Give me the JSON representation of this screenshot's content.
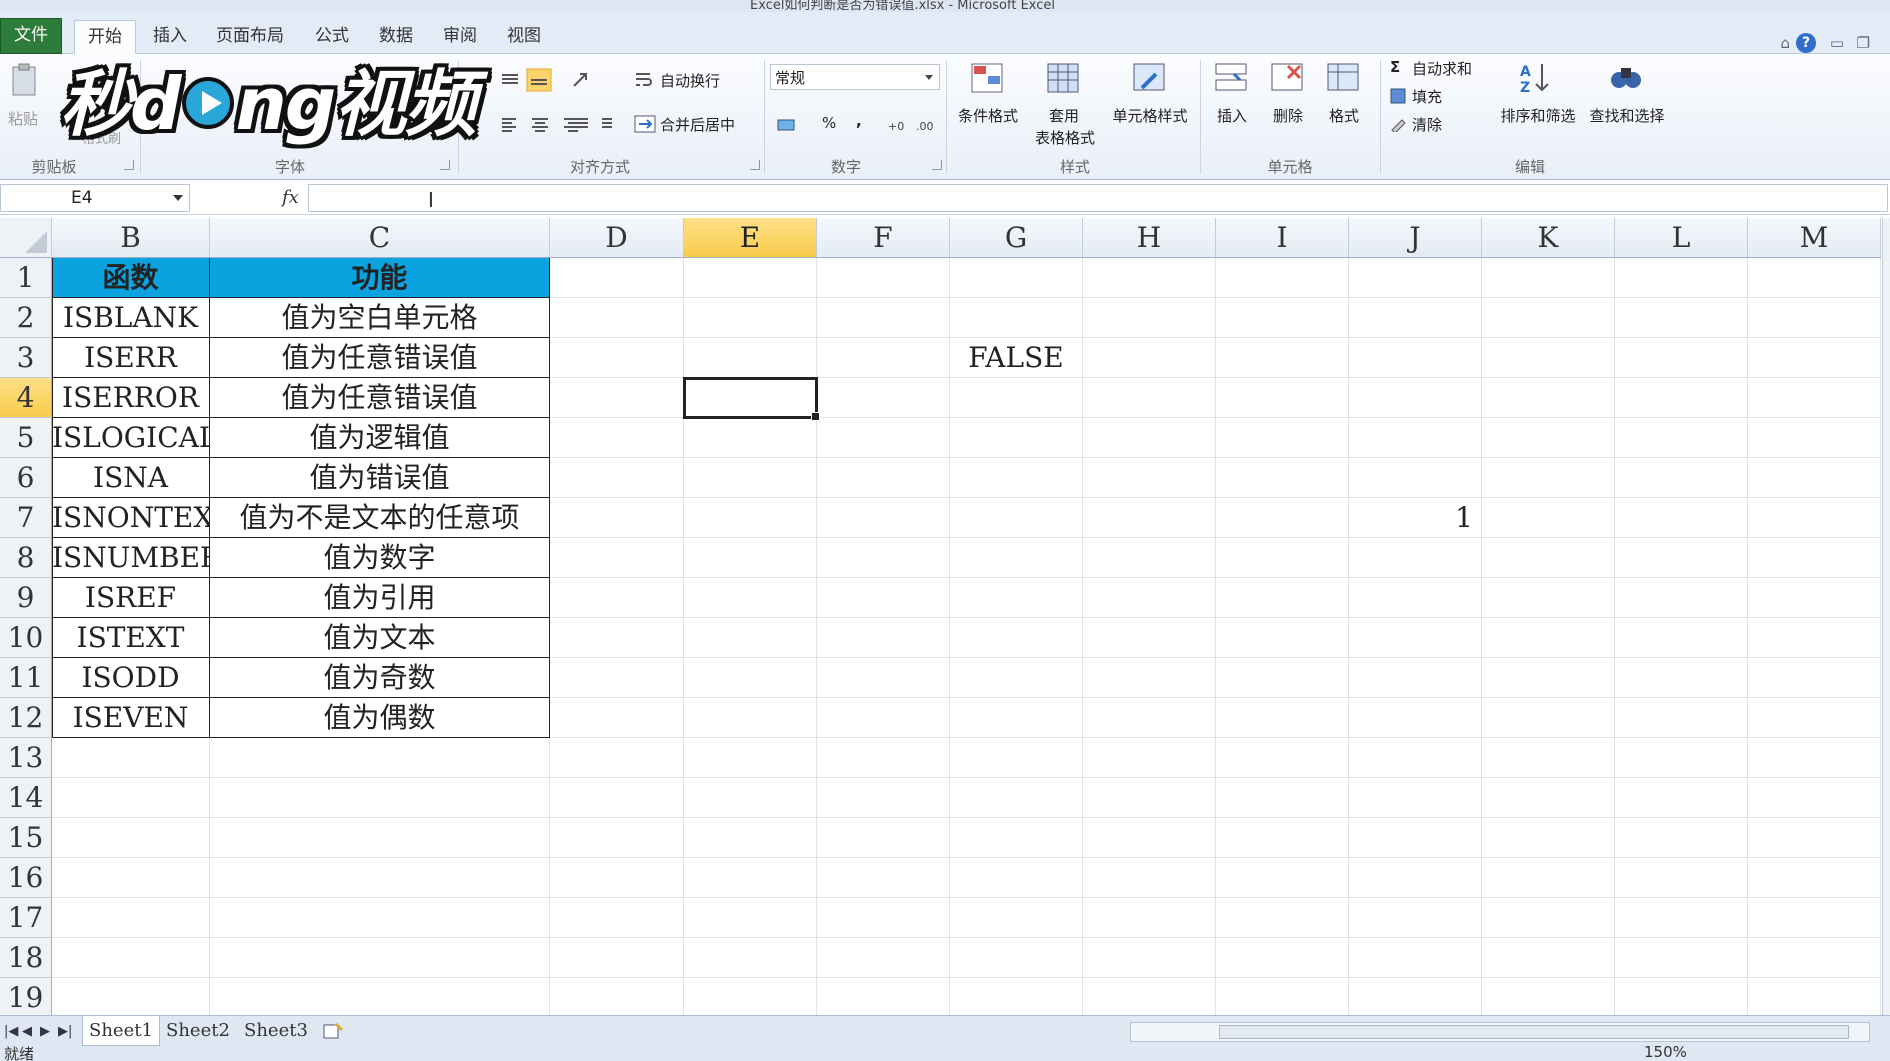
{
  "title_bar": {
    "title": "Excel如何判断是否为错误值.xlsx - Microsoft Excel"
  },
  "menu_tabs": [
    {
      "label": "文件"
    },
    {
      "label": "开始"
    },
    {
      "label": "插入"
    },
    {
      "label": "页面布局"
    },
    {
      "label": "公式"
    },
    {
      "label": "数据"
    },
    {
      "label": "审阅"
    },
    {
      "label": "视图"
    }
  ],
  "active_tab": "开始",
  "watermark": {
    "text": "秒dong视频"
  },
  "ribbon": {
    "clipboard": {
      "paste": "粘贴",
      "format_painter": "格式刷",
      "group": "剪贴板"
    },
    "font": {
      "group": "字体"
    },
    "alignment": {
      "wrap_text": "自动换行",
      "merge_center": "合并后居中",
      "group": "对齐方式"
    },
    "number": {
      "format_value": "常规",
      "percent": "%",
      "comma": ",",
      "group": "数字"
    },
    "styles": {
      "conditional": "条件格式",
      "table_line1": "套用",
      "table_line2": "表格格式",
      "cell_styles": "单元格样式",
      "group": "样式"
    },
    "cells": {
      "insert": "插入",
      "delete": "删除",
      "format": "格式",
      "group": "单元格"
    },
    "editing": {
      "autosum": "自动求和",
      "fill": "填充",
      "clear": "清除",
      "sort_filter": "排序和筛选",
      "find_select": "查找和选择",
      "group": "编辑"
    }
  },
  "formula_bar": {
    "name_box": "E4",
    "fx": "fx",
    "formula": ""
  },
  "columns": [
    "B",
    "C",
    "D",
    "E",
    "F",
    "G",
    "H",
    "I",
    "J",
    "K",
    "L",
    "M"
  ],
  "selected_column": "E",
  "selected_row": 4,
  "rows": [
    "1",
    "2",
    "3",
    "4",
    "5",
    "6",
    "7",
    "8",
    "9",
    "10",
    "11",
    "12",
    "13",
    "14",
    "15",
    "16",
    "17",
    "18",
    "19"
  ],
  "table": {
    "header": {
      "func": "函数",
      "desc": "功能"
    },
    "rows": [
      {
        "func": "ISBLANK",
        "desc": "值为空白单元格"
      },
      {
        "func": "ISERR",
        "desc": "值为任意错误值"
      },
      {
        "func": "ISERROR",
        "desc": "值为任意错误值"
      },
      {
        "func": "ISLOGICAL",
        "desc": "值为逻辑值"
      },
      {
        "func": "ISNA",
        "desc": "值为错误值"
      },
      {
        "func": "ISNONTEXT",
        "desc": "值为不是文本的任意项"
      },
      {
        "func": "ISNUMBER",
        "desc": "值为数字"
      },
      {
        "func": "ISREF",
        "desc": "值为引用"
      },
      {
        "func": "ISTEXT",
        "desc": "值为文本"
      },
      {
        "func": "ISODD",
        "desc": "值为奇数"
      },
      {
        "func": "ISEVEN",
        "desc": "值为偶数"
      }
    ]
  },
  "cells": {
    "G3": "FALSE",
    "J7": "1"
  },
  "sheets": [
    "Sheet1",
    "Sheet2",
    "Sheet3"
  ],
  "active_sheet": "Sheet1",
  "status": {
    "ready": "就绪",
    "zoom": "150%"
  },
  "colors": {
    "header_fill": "#0AA3E0",
    "selection_highlight": "#F8CC4A",
    "file_tab": "#2D7C3A"
  }
}
